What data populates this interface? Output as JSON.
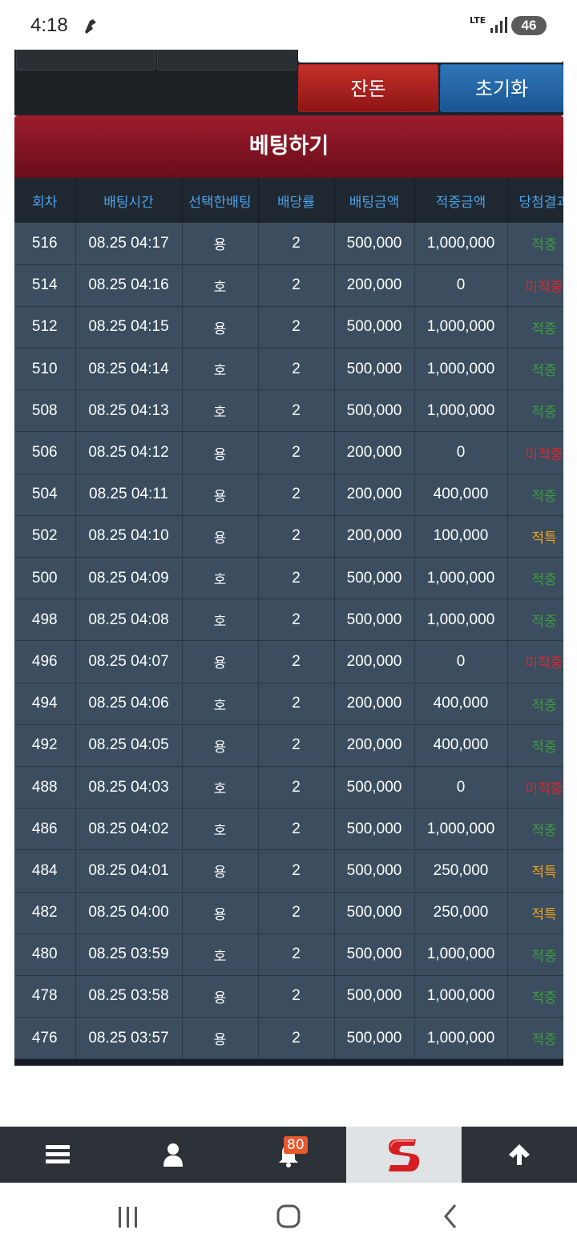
{
  "status_bar": {
    "time": "4:18",
    "network": "LTE",
    "battery": "46"
  },
  "buttons": {
    "balance": "잔돈",
    "reset": "초기화"
  },
  "bet_panel": {
    "title": "베팅하기"
  },
  "table": {
    "headers": [
      "회차",
      "배팅시간",
      "선택한배팅",
      "배당률",
      "배팅금액",
      "적중금액",
      "당첨결과"
    ],
    "rows": [
      {
        "round": "516",
        "time": "08.25 04:17",
        "pick": "용",
        "odds": "2",
        "bet": "500,000",
        "win": "1,000,000",
        "result": "적중",
        "status": "win"
      },
      {
        "round": "514",
        "time": "08.25 04:16",
        "pick": "호",
        "odds": "2",
        "bet": "200,000",
        "win": "0",
        "result": "미적중",
        "status": "lose"
      },
      {
        "round": "512",
        "time": "08.25 04:15",
        "pick": "용",
        "odds": "2",
        "bet": "500,000",
        "win": "1,000,000",
        "result": "적중",
        "status": "win"
      },
      {
        "round": "510",
        "time": "08.25 04:14",
        "pick": "호",
        "odds": "2",
        "bet": "500,000",
        "win": "1,000,000",
        "result": "적중",
        "status": "win"
      },
      {
        "round": "508",
        "time": "08.25 04:13",
        "pick": "호",
        "odds": "2",
        "bet": "500,000",
        "win": "1,000,000",
        "result": "적중",
        "status": "win"
      },
      {
        "round": "506",
        "time": "08.25 04:12",
        "pick": "용",
        "odds": "2",
        "bet": "200,000",
        "win": "0",
        "result": "미적중",
        "status": "lose"
      },
      {
        "round": "504",
        "time": "08.25 04:11",
        "pick": "용",
        "odds": "2",
        "bet": "200,000",
        "win": "400,000",
        "result": "적중",
        "status": "win"
      },
      {
        "round": "502",
        "time": "08.25 04:10",
        "pick": "용",
        "odds": "2",
        "bet": "200,000",
        "win": "100,000",
        "result": "적특",
        "status": "part"
      },
      {
        "round": "500",
        "time": "08.25 04:09",
        "pick": "호",
        "odds": "2",
        "bet": "500,000",
        "win": "1,000,000",
        "result": "적중",
        "status": "win"
      },
      {
        "round": "498",
        "time": "08.25 04:08",
        "pick": "호",
        "odds": "2",
        "bet": "500,000",
        "win": "1,000,000",
        "result": "적중",
        "status": "win"
      },
      {
        "round": "496",
        "time": "08.25 04:07",
        "pick": "용",
        "odds": "2",
        "bet": "200,000",
        "win": "0",
        "result": "미적중",
        "status": "lose"
      },
      {
        "round": "494",
        "time": "08.25 04:06",
        "pick": "호",
        "odds": "2",
        "bet": "200,000",
        "win": "400,000",
        "result": "적중",
        "status": "win"
      },
      {
        "round": "492",
        "time": "08.25 04:05",
        "pick": "용",
        "odds": "2",
        "bet": "200,000",
        "win": "400,000",
        "result": "적중",
        "status": "win"
      },
      {
        "round": "488",
        "time": "08.25 04:03",
        "pick": "호",
        "odds": "2",
        "bet": "500,000",
        "win": "0",
        "result": "미적중",
        "status": "lose"
      },
      {
        "round": "486",
        "time": "08.25 04:02",
        "pick": "호",
        "odds": "2",
        "bet": "500,000",
        "win": "1,000,000",
        "result": "적중",
        "status": "win"
      },
      {
        "round": "484",
        "time": "08.25 04:01",
        "pick": "용",
        "odds": "2",
        "bet": "500,000",
        "win": "250,000",
        "result": "적특",
        "status": "part"
      },
      {
        "round": "482",
        "time": "08.25 04:00",
        "pick": "용",
        "odds": "2",
        "bet": "500,000",
        "win": "250,000",
        "result": "적특",
        "status": "part"
      },
      {
        "round": "480",
        "time": "08.25 03:59",
        "pick": "호",
        "odds": "2",
        "bet": "500,000",
        "win": "1,000,000",
        "result": "적중",
        "status": "win"
      },
      {
        "round": "478",
        "time": "08.25 03:58",
        "pick": "용",
        "odds": "2",
        "bet": "500,000",
        "win": "1,000,000",
        "result": "적중",
        "status": "win"
      },
      {
        "round": "476",
        "time": "08.25 03:57",
        "pick": "용",
        "odds": "2",
        "bet": "500,000",
        "win": "1,000,000",
        "result": "적중",
        "status": "win"
      }
    ]
  },
  "bottom_nav": {
    "items": [
      {
        "icon": "menu-icon"
      },
      {
        "icon": "user-icon"
      },
      {
        "icon": "bell-icon",
        "badge": "80"
      },
      {
        "icon": "logo-s-icon"
      },
      {
        "icon": "arrow-up-icon"
      }
    ]
  },
  "colors": {
    "win": "#3d9e3d",
    "lose": "#e0262b",
    "partial": "#f2a317",
    "header_text": "#4fa3e6",
    "row_bg": "#3b4d5f"
  }
}
